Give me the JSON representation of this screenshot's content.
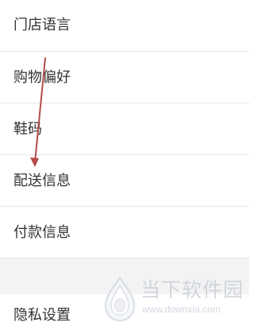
{
  "settings": {
    "items": [
      {
        "label": "门店语言"
      },
      {
        "label": "购物偏好"
      },
      {
        "label": "鞋码"
      },
      {
        "label": "配送信息"
      },
      {
        "label": "付款信息"
      },
      {
        "label": "隐私设置"
      }
    ]
  },
  "annotation": {
    "color": "#b64a4a"
  },
  "watermark": {
    "title": "当下软件园",
    "url": "www.downxia.com"
  },
  "colors": {
    "background": "#ffffff",
    "divider": "#e6e6e6",
    "section_gap": "#f3f3f3",
    "text": "#333333",
    "watermark": "#c7ccd6"
  }
}
